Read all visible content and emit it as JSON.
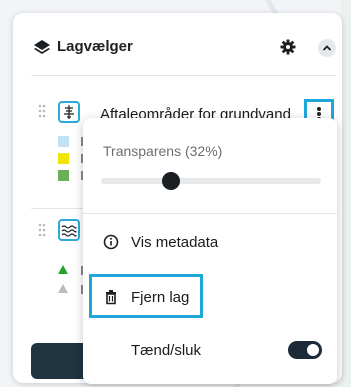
{
  "panel": {
    "title": "Lagvælger",
    "icons": {
      "header": "layers-icon",
      "settings": "gear-icon",
      "collapse": "chevron-up-icon"
    }
  },
  "layers": [
    {
      "name": "Aftaleområder for grundvand",
      "icon": "well-pump-icon",
      "legend_colors": [
        "#bfe3f2",
        "#f0e600",
        "#6aae58"
      ]
    },
    {
      "name": "",
      "icon": "water-waves-icon",
      "legend_colors": [
        "#22a52e",
        "#b9bcbf"
      ]
    }
  ],
  "menu": {
    "transparency_label": "Transparens (32%)",
    "transparency_value": 0.32,
    "items": [
      {
        "label": "Vis metadata",
        "icon": "info-circle-icon"
      },
      {
        "label": "Fjern lag",
        "icon": "trash-icon"
      }
    ],
    "toggle_label": "Tænd/sluk",
    "toggle_on": true
  },
  "colors": {
    "highlight": "#1ea7d8",
    "dark": "#1b2a36",
    "icon_border": "#2ba9d8"
  }
}
